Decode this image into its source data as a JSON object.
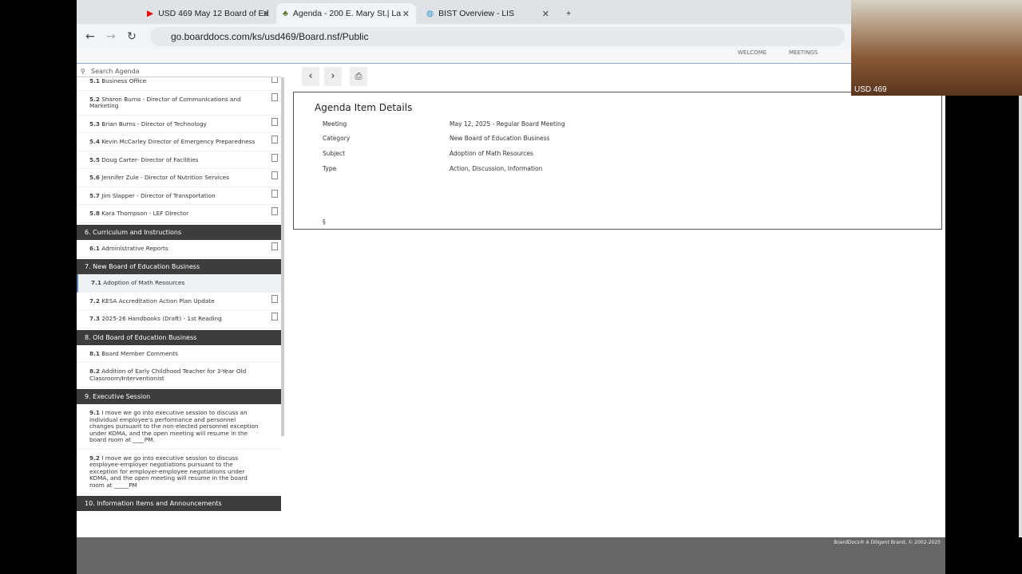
{
  "browser": {
    "tabs": [
      {
        "title": "USD 469 May 12 Board of Ed"
      },
      {
        "title": "Agenda - 200 E. Mary St.| La"
      },
      {
        "title": "BIST Overview - LIS"
      }
    ],
    "url": "go.boarddocs.com/ks/usd469/Board.nsf/Public"
  },
  "header": {
    "nav": [
      "WELCOME",
      "MEETINGS"
    ]
  },
  "camera": {
    "label": "USD 469"
  },
  "search": {
    "placeholder": "Search Agenda"
  },
  "agenda": [
    {
      "type": "item",
      "num": "5.1",
      "label": "Business Office",
      "doc": true
    },
    {
      "type": "item",
      "num": "5.2",
      "label": "Sharon Burns - Director of Communications and Marketing",
      "doc": true
    },
    {
      "type": "item",
      "num": "5.3",
      "label": "Brian Burns - Director of Technology",
      "doc": true
    },
    {
      "type": "item",
      "num": "5.4",
      "label": "Kevin McCarley Director of Emergency Preparedness",
      "doc": true
    },
    {
      "type": "item",
      "num": "5.5",
      "label": "Doug Carter- Director of Facilities",
      "doc": true
    },
    {
      "type": "item",
      "num": "5.6",
      "label": "Jennifer Zule - Director of Nutrition Services",
      "doc": true
    },
    {
      "type": "item",
      "num": "5.7",
      "label": "Jim Slapper - Director of Transportation",
      "doc": true
    },
    {
      "type": "item",
      "num": "5.8",
      "label": "Kara Thompson - LEF Director",
      "doc": true
    },
    {
      "type": "section",
      "label": "6. Curriculum and Instructions"
    },
    {
      "type": "item",
      "num": "6.1",
      "label": "Administrative Reports",
      "doc": true
    },
    {
      "type": "section",
      "label": "7. New Board of Education Business"
    },
    {
      "type": "item",
      "num": "7.1",
      "label": "Adoption of Math Resources",
      "doc": false,
      "selected": true
    },
    {
      "type": "item",
      "num": "7.2",
      "label": "KESA Accreditation Action Plan Update",
      "doc": true
    },
    {
      "type": "item",
      "num": "7.3",
      "label": "2025-26 Handbooks (Draft) - 1st Reading",
      "doc": true
    },
    {
      "type": "section",
      "label": "8. Old Board of Education Business"
    },
    {
      "type": "item",
      "num": "8.1",
      "label": "Board Member Comments",
      "doc": false
    },
    {
      "type": "item",
      "num": "8.2",
      "label": "Addition of Early Childhood Teacher for 3-Year Old Classroom/Interventionist",
      "doc": false
    },
    {
      "type": "section",
      "label": "9. Executive Session"
    },
    {
      "type": "item",
      "num": "9.1",
      "label": "I move we go into executive session to discuss an individual employee's performance and personnel changes pursuant to the non-elected personnel exception under KOMA, and the open meeting will resume in the board room at ____PM.",
      "doc": false
    },
    {
      "type": "item",
      "num": "9.2",
      "label": "I move we go into executive session to discuss employee-employer negotiations pursuant to the exception for employer-employee negotiations under KOMA, and the open meeting will resume in the board room at _____PM",
      "doc": false
    },
    {
      "type": "section",
      "label": "10. Information Items and Announcements"
    }
  ],
  "details": {
    "title": "Agenda Item Details",
    "rows": [
      {
        "k": "Meeting",
        "v": "May 12, 2025 - Regular Board Meeting"
      },
      {
        "k": "Category",
        "v": "New Board of Education Business"
      },
      {
        "k": "Subject",
        "v": "Adoption of Math Resources"
      },
      {
        "k": "Type",
        "v": "Action, Discussion, Information"
      }
    ],
    "mark": "§"
  },
  "footer": {
    "text": "BoardDocs® A Diligent Brand, © 2002-2025"
  }
}
